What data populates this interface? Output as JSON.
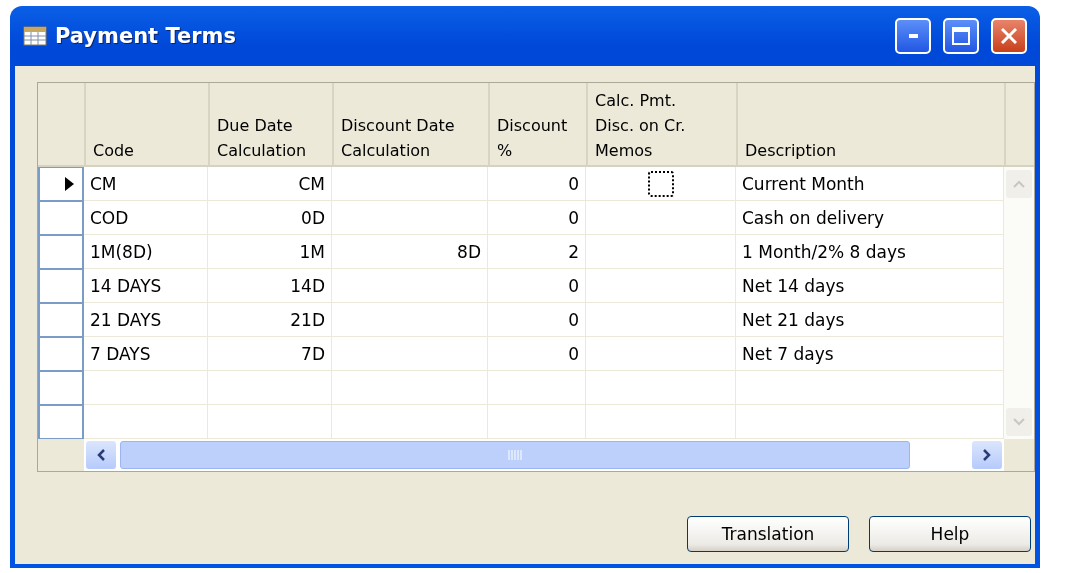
{
  "window": {
    "title": "Payment Terms"
  },
  "columns": [
    {
      "label": "Code"
    },
    {
      "label": "Due Date Calculation"
    },
    {
      "label": "Discount Date Calculation"
    },
    {
      "label": "Discount %"
    },
    {
      "label": "Calc. Pmt. Disc. on Cr. Memos"
    },
    {
      "label": "Description"
    }
  ],
  "rows": [
    {
      "current": true,
      "cells": [
        "CM",
        "CM",
        "",
        "0",
        {
          "checked": false
        },
        "Current Month"
      ]
    },
    {
      "current": false,
      "cells": [
        "COD",
        "0D",
        "",
        "0",
        "",
        "Cash on delivery"
      ]
    },
    {
      "current": false,
      "cells": [
        "1M(8D)",
        "1M",
        "8D",
        "2",
        "",
        "1 Month/2% 8 days"
      ]
    },
    {
      "current": false,
      "cells": [
        "14 DAYS",
        "14D",
        "",
        "0",
        "",
        "Net 14 days"
      ]
    },
    {
      "current": false,
      "cells": [
        "21 DAYS",
        "21D",
        "",
        "0",
        "",
        "Net 21 days"
      ]
    },
    {
      "current": false,
      "cells": [
        "7 DAYS",
        "7D",
        "",
        "0",
        "",
        "Net 7 days"
      ]
    }
  ],
  "buttons": [
    {
      "label": "Translation"
    },
    {
      "label": "Help"
    }
  ]
}
